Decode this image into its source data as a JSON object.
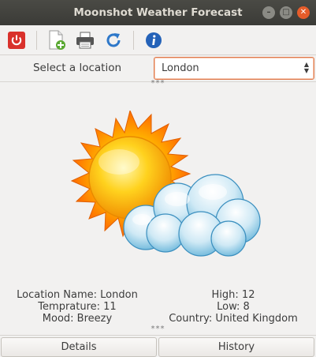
{
  "window": {
    "title": "Moonshot Weather Forecast"
  },
  "toolbar": {
    "buttons": [
      {
        "icon": "power-icon",
        "color": "#d9312b"
      },
      {
        "icon": "new-document-icon",
        "color": "#5aa832"
      },
      {
        "icon": "printer-icon",
        "color": "#555555"
      },
      {
        "icon": "refresh-icon",
        "color": "#2e78c9"
      },
      {
        "icon": "info-icon",
        "color": "#2462b8"
      }
    ]
  },
  "location": {
    "label": "Select a location",
    "selected": "London"
  },
  "splitter_marks": "***",
  "weather": {
    "condition_icon": "sun-behind-cloud-icon",
    "location_name": "Location Name: London",
    "temperature": "Temprature: 11",
    "mood": "Mood: Breezy",
    "high": "High: 12",
    "low": "Low: 8",
    "country": "Country: United Kingdom"
  },
  "tabs": {
    "details": "Details",
    "history": "History"
  },
  "colors": {
    "accent": "#e07a4d",
    "titlebar": "#3b3b37"
  }
}
